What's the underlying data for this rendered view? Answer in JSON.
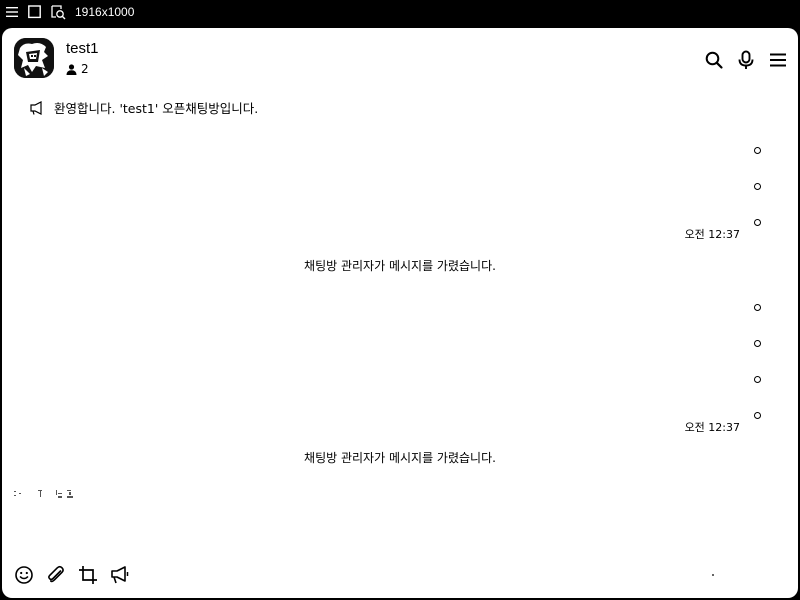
{
  "titlebar": {
    "resolution": "1916x1000",
    "icons": [
      "menu-icon",
      "window-icon",
      "screenshot-settings-icon"
    ]
  },
  "header": {
    "room_name": "test1",
    "member_count": "2",
    "icons": [
      "search-icon",
      "microphone-icon",
      "menu-icon"
    ]
  },
  "notice": {
    "text": "환영합니다. 'test1' 오픈채팅방입니다."
  },
  "messages": [
    {
      "time": "오전 12:37",
      "system": "채팅방 관리자가 메시지를 가렸습니다."
    },
    {
      "time": "오전 12:37",
      "system": "채팅방 관리자가 메시지를 가렸습니다."
    }
  ],
  "toolbar": {
    "icons": [
      "emoji-icon",
      "attach-icon",
      "crop-icon",
      "megaphone-icon"
    ]
  }
}
